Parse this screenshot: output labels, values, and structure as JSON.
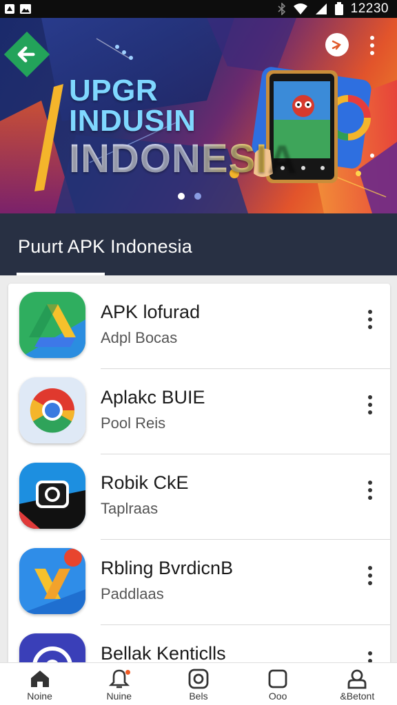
{
  "status_bar": {
    "time": "12230",
    "left_icons": [
      "notification-icon",
      "image-icon"
    ],
    "right_icons": [
      "bluetooth-icon",
      "wifi-icon",
      "signal-icon",
      "battery-icon"
    ]
  },
  "banner": {
    "headline_line1": "UPGR INDUSIN",
    "headline_line2": "INDONESIA",
    "back_icon": "arrow-left-icon",
    "action_icon": "share-icon",
    "more_icon": "more-vert-icon",
    "slides_total": 2,
    "slide_active": 1
  },
  "header": {
    "title": "Puurt APK  Indonesia"
  },
  "apps": [
    {
      "name": "APK lofurad",
      "subtitle": "Adpl Bocas",
      "icon": "drive-icon"
    },
    {
      "name": "Aplakc BUIE",
      "subtitle": "Pool Reis",
      "icon": "chrome-icon"
    },
    {
      "name": "Robik CkE",
      "subtitle": "Taplraas",
      "icon": "camera-icon"
    },
    {
      "name": "Rbling BvrdicnB",
      "subtitle": "Paddlaas",
      "icon": "pencil-app-icon"
    },
    {
      "name": "Bellak Kenticlls",
      "subtitle": "",
      "icon": "disc-app-icon"
    }
  ],
  "bottom_nav": [
    {
      "label": "Noine",
      "icon": "home-icon"
    },
    {
      "label": "Nuine",
      "icon": "bell-icon",
      "badge": true
    },
    {
      "label": "Bels",
      "icon": "instagram-icon"
    },
    {
      "label": "Ooo",
      "icon": "square-icon"
    },
    {
      "label": "&Betont",
      "icon": "account-icon"
    }
  ],
  "colors": {
    "header_bg": "#283043",
    "accent_orange": "#f15a24",
    "banner_blue": "#1a2a6b",
    "banner_orange": "#f39a2b"
  }
}
